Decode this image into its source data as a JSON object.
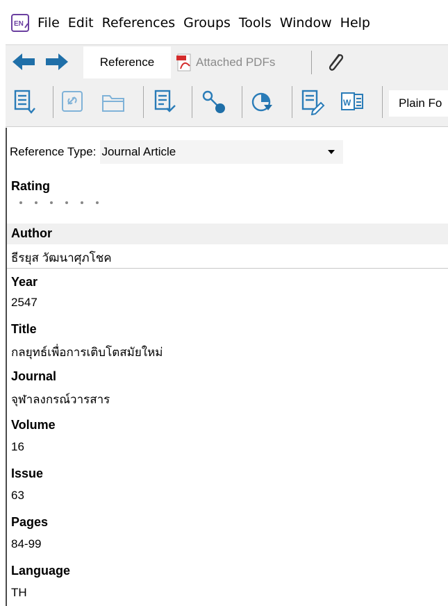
{
  "menubar": {
    "app_icon": "endnote-logo",
    "app_icon_text": "EN",
    "items": [
      "File",
      "Edit",
      "References",
      "Groups",
      "Tools",
      "Window",
      "Help"
    ]
  },
  "navbar": {
    "back_icon": "back-arrow-icon",
    "forward_icon": "forward-arrow-icon",
    "tab_reference": "Reference",
    "tab_pdfs": "Attached PDFs",
    "attach_icon": "paperclip-icon"
  },
  "toolbar": {
    "icons": [
      "insert-citation-icon",
      "open-link-icon",
      "open-folder-icon",
      "format-bibliography-icon",
      "find-fulltext-icon",
      "cite-while-you-write-icon",
      "edit-icon",
      "word-icon"
    ],
    "output_style": "Plain Fo"
  },
  "panel": {
    "ref_type_label": "Reference Type:",
    "ref_type_value": "Journal Article",
    "fields": {
      "rating": {
        "label": "Rating",
        "value": 0,
        "max": 5
      },
      "author": {
        "label": "Author",
        "value": "ธีรยุส วัฒนาศุภโชค"
      },
      "year": {
        "label": "Year",
        "value": "2547"
      },
      "title": {
        "label": "Title",
        "value": "กลยุทธ์เพื่อการเติบโตสมัยใหม่"
      },
      "journal": {
        "label": "Journal",
        "value": "จุฬาลงกรณ์วารสาร"
      },
      "volume": {
        "label": "Volume",
        "value": "16"
      },
      "issue": {
        "label": "Issue",
        "value": "63"
      },
      "pages": {
        "label": "Pages",
        "value": "84-99"
      },
      "language": {
        "label": "Language",
        "value": "TH"
      }
    }
  },
  "colors": {
    "nav_arrow": "#1f6fa8",
    "toolbar_icon": "#2a7cb8",
    "pdf_red": "#d42b2b"
  }
}
